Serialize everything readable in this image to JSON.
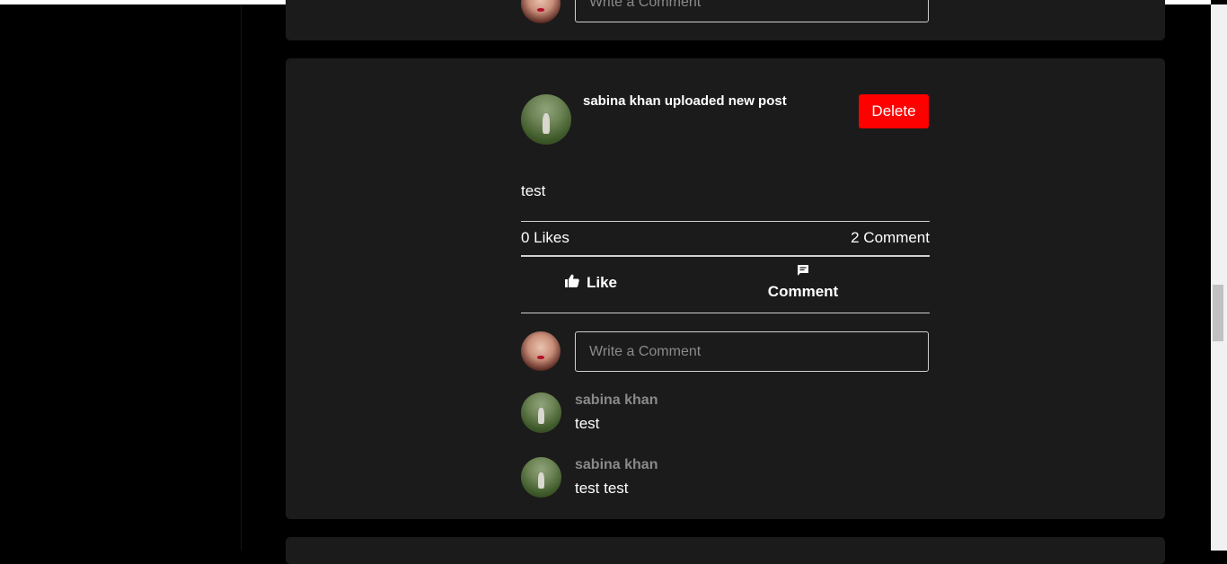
{
  "previous_post": {
    "comment_placeholder": "Write a Comment"
  },
  "post": {
    "title": "sabina khan uploaded new post",
    "delete_label": "Delete",
    "text": "test",
    "likes_count": "0 Likes",
    "comments_count": "2 Comment",
    "like_label": "Like",
    "comment_label": "Comment",
    "comment_placeholder": "Write a Comment",
    "comments": [
      {
        "author": "sabina khan",
        "text": "test"
      },
      {
        "author": "sabina khan",
        "text": "test test"
      }
    ]
  },
  "icons": {
    "like": "thumbs-up-icon",
    "comment": "comment-bubble-icon"
  },
  "colors": {
    "delete": "#ff0000",
    "card": "#1b1b1b",
    "background": "#000000",
    "author": "#8a8a8a"
  }
}
